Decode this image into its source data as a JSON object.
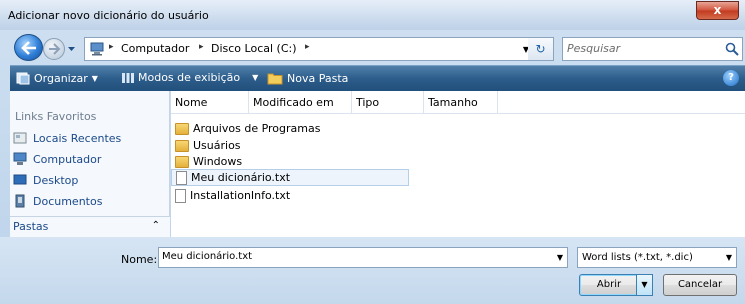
{
  "window": {
    "title": "Adicionar novo dicionário do usuário",
    "close_label": "x"
  },
  "address": {
    "crumbs": [
      "Computador",
      "Disco Local (C:)"
    ],
    "separator": "▸",
    "refresh_symbol": "↻"
  },
  "search": {
    "placeholder": "Pesquisar"
  },
  "toolbar": {
    "organize_label": "Organizar",
    "views_label": "Modos de exibição",
    "new_folder_label": "Nova Pasta",
    "help_label": "?"
  },
  "favorites": {
    "title": "Links Favoritos",
    "items": [
      {
        "label": "Locais Recentes",
        "icon": "recent-places-icon"
      },
      {
        "label": "Computador",
        "icon": "computer-icon"
      },
      {
        "label": "Desktop",
        "icon": "desktop-icon"
      },
      {
        "label": "Documentos",
        "icon": "documents-icon"
      }
    ]
  },
  "folders_section": {
    "label": "Pastas",
    "chevron": "⌃"
  },
  "columns": [
    "Nome",
    "Modificado em",
    "Tipo",
    "Tamanho"
  ],
  "files": [
    {
      "name": "Arquivos de Programas",
      "kind": "folder",
      "selected": false
    },
    {
      "name": "Usuários",
      "kind": "folder",
      "selected": false
    },
    {
      "name": "Windows",
      "kind": "folder",
      "selected": false
    },
    {
      "name": "Meu dicionário.txt",
      "kind": "file",
      "selected": true
    },
    {
      "name": "InstallationInfo.txt",
      "kind": "file",
      "selected": false
    }
  ],
  "filename": {
    "label": "Nome:",
    "value": "Meu dicionário.txt"
  },
  "filetype": {
    "selected": "Word lists (*.txt, *.dic)"
  },
  "buttons": {
    "open_label": "Abrir",
    "cancel_label": "Cancelar"
  },
  "colors": {
    "toolbar": "#2d5d8b",
    "link": "#1b4a8a",
    "selection": "#edf4fc"
  }
}
